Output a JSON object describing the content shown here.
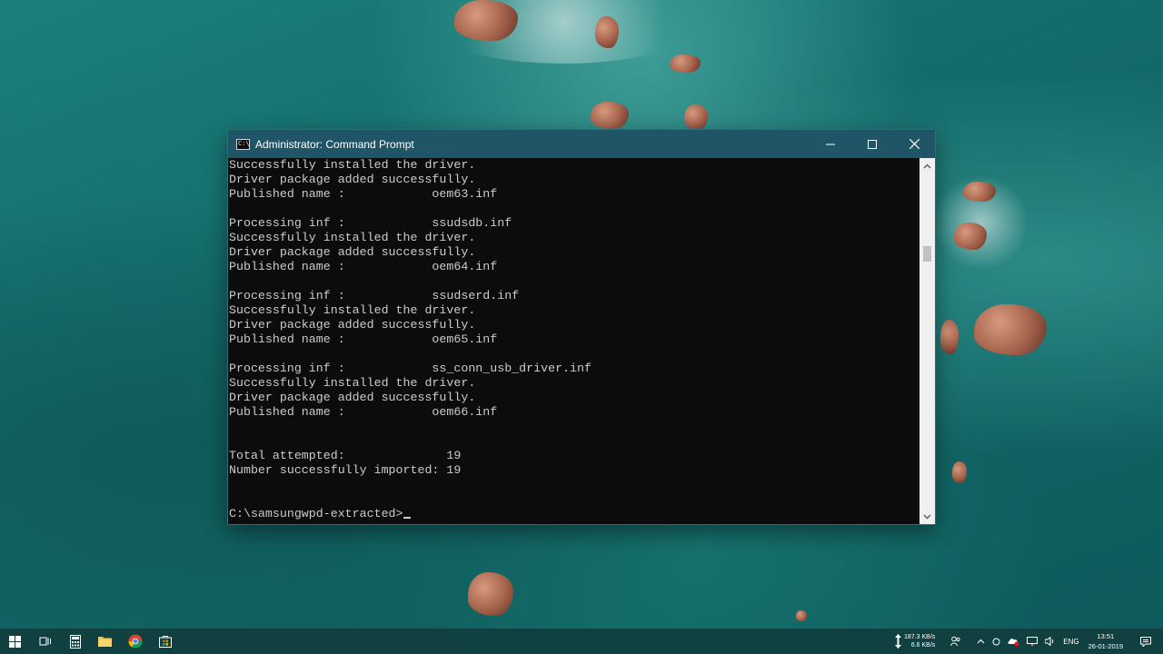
{
  "window": {
    "title": "Administrator: Command Prompt",
    "icon_label": "C:\\",
    "controls": {
      "minimize": "minimize-icon",
      "maximize": "maximize-icon",
      "close": "close-icon"
    }
  },
  "console": {
    "lines": [
      "Successfully installed the driver.",
      "Driver package added successfully.",
      "Published name :            oem63.inf",
      "",
      "Processing inf :            ssudsdb.inf",
      "Successfully installed the driver.",
      "Driver package added successfully.",
      "Published name :            oem64.inf",
      "",
      "Processing inf :            ssudserd.inf",
      "Successfully installed the driver.",
      "Driver package added successfully.",
      "Published name :            oem65.inf",
      "",
      "Processing inf :            ss_conn_usb_driver.inf",
      "Successfully installed the driver.",
      "Driver package added successfully.",
      "Published name :            oem66.inf",
      "",
      "",
      "Total attempted:              19",
      "Number successfully imported: 19",
      "",
      ""
    ],
    "prompt": "C:\\samsungwpd-extracted>"
  },
  "taskbar": {
    "apps": [
      "windows-start-icon",
      "task-view-icon",
      "calculator-icon",
      "file-explorer-icon",
      "chrome-icon",
      "store-icon"
    ],
    "net_up": "187.3 KB/s",
    "net_down": "6.6 KB/s",
    "language": "ENG",
    "time": "13:51",
    "date": "26-01-2019",
    "colors": {
      "taskbar": "#103e3e",
      "titlebar": "#1f5566",
      "console_bg": "#0c0c0c",
      "console_fg": "#cccccc"
    }
  }
}
